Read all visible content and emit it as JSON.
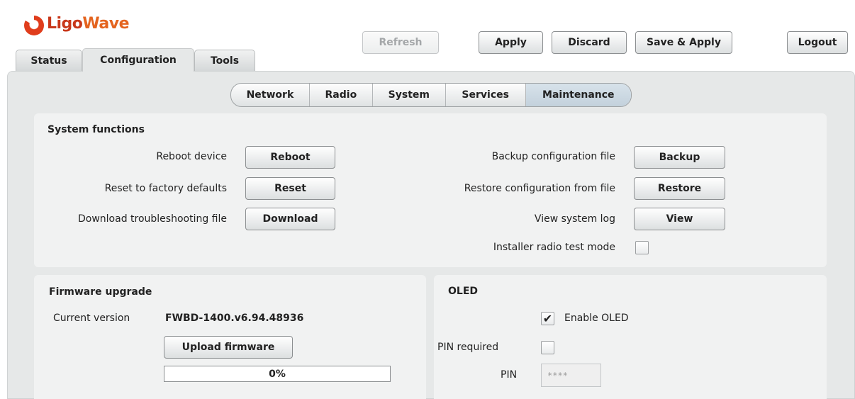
{
  "header": {
    "logo_text_1": "Ligo",
    "logo_text_2": "Wave",
    "tabs": [
      "Status",
      "Configuration",
      "Tools"
    ],
    "active_tab": "Configuration",
    "buttons": {
      "refresh": "Refresh",
      "apply": "Apply",
      "discard": "Discard",
      "save_apply": "Save & Apply",
      "logout": "Logout"
    }
  },
  "subnav": {
    "items": [
      "Network",
      "Radio",
      "System",
      "Services",
      "Maintenance"
    ],
    "active": "Maintenance"
  },
  "system_functions": {
    "title": "System functions",
    "rows_left": [
      {
        "label": "Reboot device",
        "button": "Reboot"
      },
      {
        "label": "Reset to factory defaults",
        "button": "Reset"
      },
      {
        "label": "Download troubleshooting file",
        "button": "Download"
      }
    ],
    "rows_right": [
      {
        "label": "Backup configuration file",
        "button": "Backup"
      },
      {
        "label": "Restore configuration from file",
        "button": "Restore"
      },
      {
        "label": "View system log",
        "button": "View"
      }
    ],
    "installer_test_label": "Installer radio test mode",
    "installer_test_checked": false
  },
  "firmware": {
    "title": "Firmware upgrade",
    "current_version_label": "Current version",
    "current_version": "FWBD-1400.v6.94.48936",
    "upload_button": "Upload firmware",
    "progress_text": "0%",
    "progress_fraction": 0
  },
  "oled": {
    "title": "OLED",
    "enable_label": "Enable OLED",
    "enable_checked": true,
    "pin_required_label": "PIN required",
    "pin_required_checked": false,
    "pin_label": "PIN",
    "pin_value": "****"
  },
  "colors": {
    "panel": "#e6e8e8",
    "card": "#f1f2f2",
    "logo_red": "#c8371a",
    "logo_orange": "#e4641f"
  }
}
